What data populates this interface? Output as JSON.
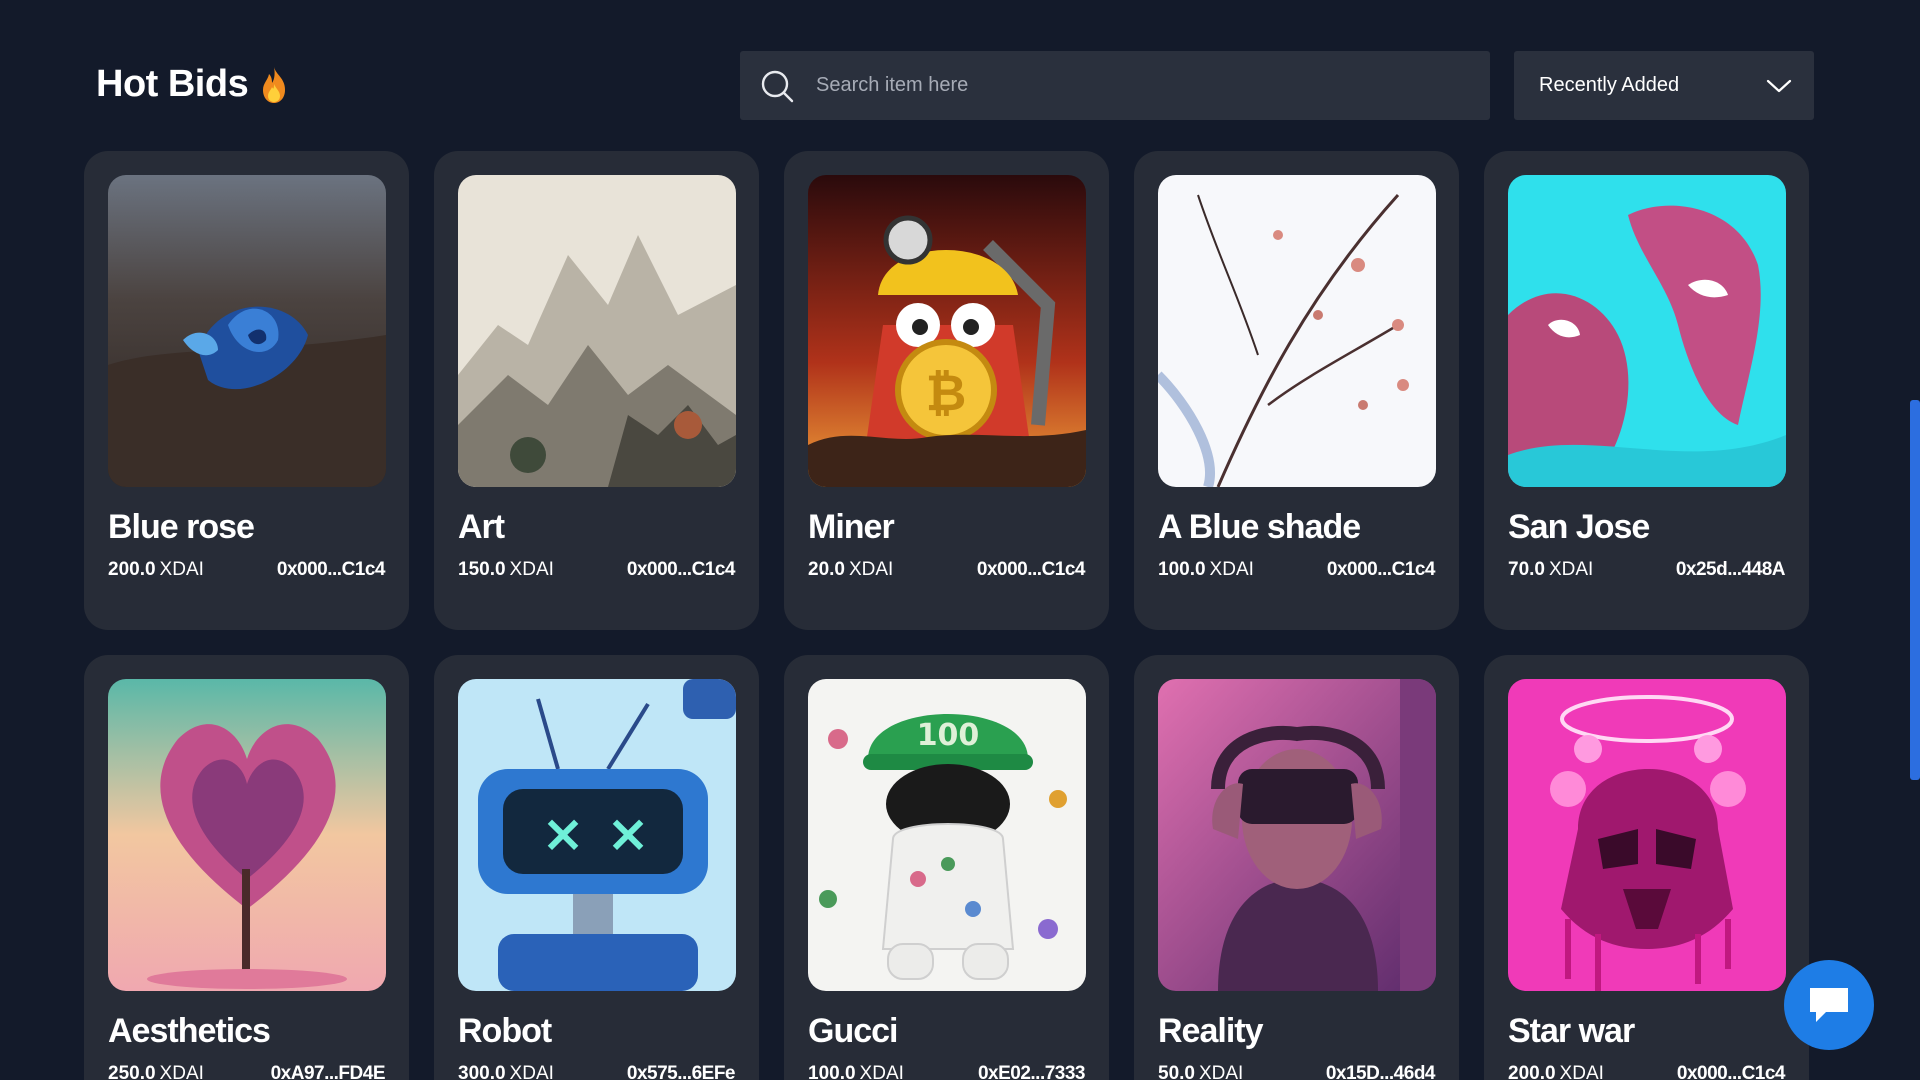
{
  "header": {
    "title": "Hot Bids",
    "title_icon": "fire-icon"
  },
  "search": {
    "placeholder": "Search item here",
    "value": "",
    "icon": "search-icon"
  },
  "sort": {
    "selected": "Recently Added",
    "icon": "chevron-down-icon"
  },
  "cards": [
    {
      "name": "Blue rose",
      "price": "200.0",
      "currency": "XDAI",
      "owner": "0x000...C1c4",
      "art": "blue-rose"
    },
    {
      "name": "Art",
      "price": "150.0",
      "currency": "XDAI",
      "owner": "0x000...C1c4",
      "art": "landscape"
    },
    {
      "name": "Miner",
      "price": "20.0",
      "currency": "XDAI",
      "owner": "0x000...C1c4",
      "art": "miner"
    },
    {
      "name": "A Blue shade",
      "price": "100.0",
      "currency": "XDAI",
      "owner": "0x000...C1c4",
      "art": "branches"
    },
    {
      "name": "San Jose",
      "price": "70.0",
      "currency": "XDAI",
      "owner": "0x25d...448A",
      "art": "faces"
    },
    {
      "name": "Aesthetics",
      "price": "250.0",
      "currency": "XDAI",
      "owner": "0xA97...FD4E",
      "art": "tree"
    },
    {
      "name": "Robot",
      "price": "300.0",
      "currency": "XDAI",
      "owner": "0x575...6EFe",
      "art": "robot"
    },
    {
      "name": "Gucci",
      "price": "100.0",
      "currency": "XDAI",
      "owner": "0xE02...7333",
      "art": "gucci"
    },
    {
      "name": "Reality",
      "price": "50.0",
      "currency": "XDAI",
      "owner": "0x15D...46d4",
      "art": "vr"
    },
    {
      "name": "Star war",
      "price": "200.0",
      "currency": "XDAI",
      "owner": "0x000...C1c4",
      "art": "helmet"
    }
  ],
  "chat": {
    "icon": "chat-bubble-icon"
  },
  "colors": {
    "background": "#131a2a",
    "card": "#272c37",
    "input": "#2a303d",
    "accent": "#1e7de6"
  }
}
